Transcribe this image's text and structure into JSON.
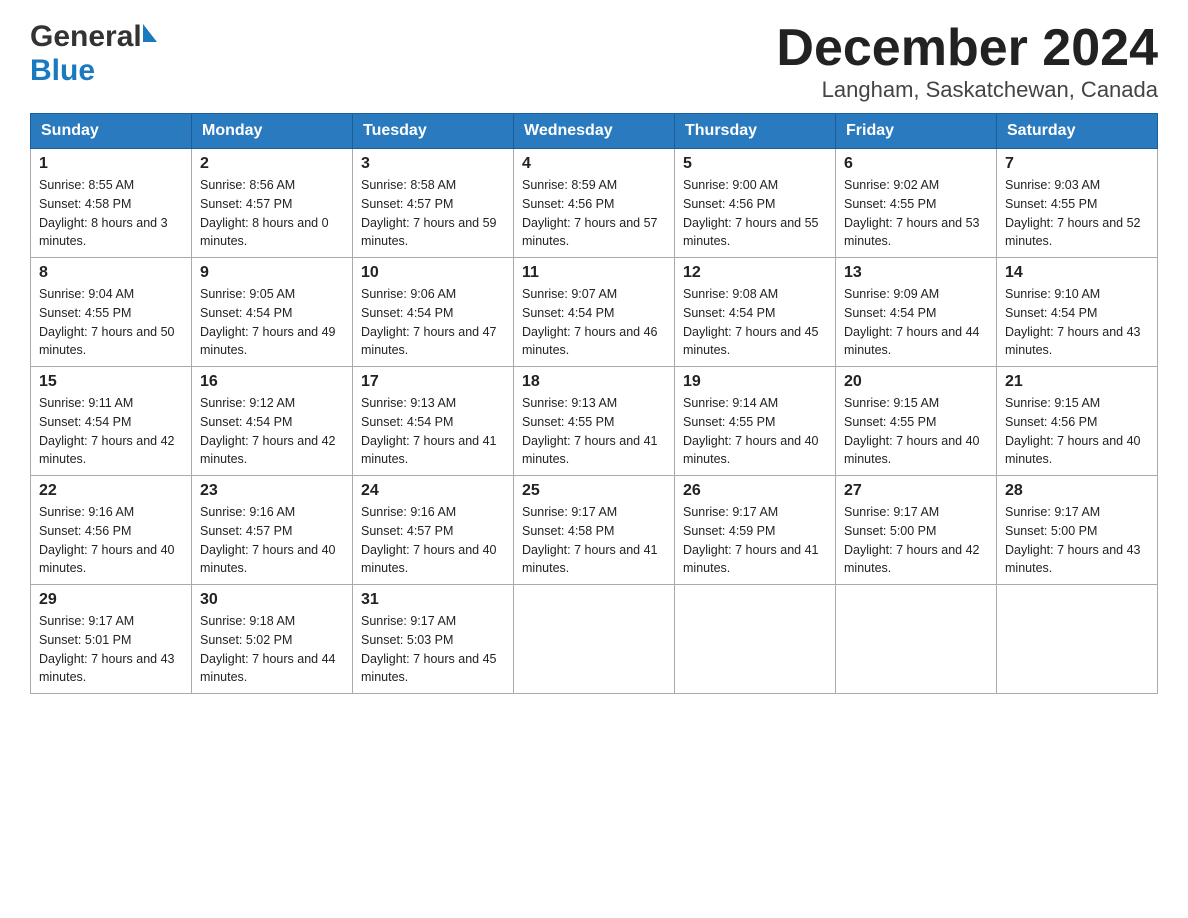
{
  "header": {
    "logo_general": "General",
    "logo_blue": "Blue",
    "title": "December 2024",
    "subtitle": "Langham, Saskatchewan, Canada"
  },
  "calendar": {
    "days_of_week": [
      "Sunday",
      "Monday",
      "Tuesday",
      "Wednesday",
      "Thursday",
      "Friday",
      "Saturday"
    ],
    "weeks": [
      [
        {
          "day": "1",
          "sunrise": "8:55 AM",
          "sunset": "4:58 PM",
          "daylight": "8 hours and 3 minutes."
        },
        {
          "day": "2",
          "sunrise": "8:56 AM",
          "sunset": "4:57 PM",
          "daylight": "8 hours and 0 minutes."
        },
        {
          "day": "3",
          "sunrise": "8:58 AM",
          "sunset": "4:57 PM",
          "daylight": "7 hours and 59 minutes."
        },
        {
          "day": "4",
          "sunrise": "8:59 AM",
          "sunset": "4:56 PM",
          "daylight": "7 hours and 57 minutes."
        },
        {
          "day": "5",
          "sunrise": "9:00 AM",
          "sunset": "4:56 PM",
          "daylight": "7 hours and 55 minutes."
        },
        {
          "day": "6",
          "sunrise": "9:02 AM",
          "sunset": "4:55 PM",
          "daylight": "7 hours and 53 minutes."
        },
        {
          "day": "7",
          "sunrise": "9:03 AM",
          "sunset": "4:55 PM",
          "daylight": "7 hours and 52 minutes."
        }
      ],
      [
        {
          "day": "8",
          "sunrise": "9:04 AM",
          "sunset": "4:55 PM",
          "daylight": "7 hours and 50 minutes."
        },
        {
          "day": "9",
          "sunrise": "9:05 AM",
          "sunset": "4:54 PM",
          "daylight": "7 hours and 49 minutes."
        },
        {
          "day": "10",
          "sunrise": "9:06 AM",
          "sunset": "4:54 PM",
          "daylight": "7 hours and 47 minutes."
        },
        {
          "day": "11",
          "sunrise": "9:07 AM",
          "sunset": "4:54 PM",
          "daylight": "7 hours and 46 minutes."
        },
        {
          "day": "12",
          "sunrise": "9:08 AM",
          "sunset": "4:54 PM",
          "daylight": "7 hours and 45 minutes."
        },
        {
          "day": "13",
          "sunrise": "9:09 AM",
          "sunset": "4:54 PM",
          "daylight": "7 hours and 44 minutes."
        },
        {
          "day": "14",
          "sunrise": "9:10 AM",
          "sunset": "4:54 PM",
          "daylight": "7 hours and 43 minutes."
        }
      ],
      [
        {
          "day": "15",
          "sunrise": "9:11 AM",
          "sunset": "4:54 PM",
          "daylight": "7 hours and 42 minutes."
        },
        {
          "day": "16",
          "sunrise": "9:12 AM",
          "sunset": "4:54 PM",
          "daylight": "7 hours and 42 minutes."
        },
        {
          "day": "17",
          "sunrise": "9:13 AM",
          "sunset": "4:54 PM",
          "daylight": "7 hours and 41 minutes."
        },
        {
          "day": "18",
          "sunrise": "9:13 AM",
          "sunset": "4:55 PM",
          "daylight": "7 hours and 41 minutes."
        },
        {
          "day": "19",
          "sunrise": "9:14 AM",
          "sunset": "4:55 PM",
          "daylight": "7 hours and 40 minutes."
        },
        {
          "day": "20",
          "sunrise": "9:15 AM",
          "sunset": "4:55 PM",
          "daylight": "7 hours and 40 minutes."
        },
        {
          "day": "21",
          "sunrise": "9:15 AM",
          "sunset": "4:56 PM",
          "daylight": "7 hours and 40 minutes."
        }
      ],
      [
        {
          "day": "22",
          "sunrise": "9:16 AM",
          "sunset": "4:56 PM",
          "daylight": "7 hours and 40 minutes."
        },
        {
          "day": "23",
          "sunrise": "9:16 AM",
          "sunset": "4:57 PM",
          "daylight": "7 hours and 40 minutes."
        },
        {
          "day": "24",
          "sunrise": "9:16 AM",
          "sunset": "4:57 PM",
          "daylight": "7 hours and 40 minutes."
        },
        {
          "day": "25",
          "sunrise": "9:17 AM",
          "sunset": "4:58 PM",
          "daylight": "7 hours and 41 minutes."
        },
        {
          "day": "26",
          "sunrise": "9:17 AM",
          "sunset": "4:59 PM",
          "daylight": "7 hours and 41 minutes."
        },
        {
          "day": "27",
          "sunrise": "9:17 AM",
          "sunset": "5:00 PM",
          "daylight": "7 hours and 42 minutes."
        },
        {
          "day": "28",
          "sunrise": "9:17 AM",
          "sunset": "5:00 PM",
          "daylight": "7 hours and 43 minutes."
        }
      ],
      [
        {
          "day": "29",
          "sunrise": "9:17 AM",
          "sunset": "5:01 PM",
          "daylight": "7 hours and 43 minutes."
        },
        {
          "day": "30",
          "sunrise": "9:18 AM",
          "sunset": "5:02 PM",
          "daylight": "7 hours and 44 minutes."
        },
        {
          "day": "31",
          "sunrise": "9:17 AM",
          "sunset": "5:03 PM",
          "daylight": "7 hours and 45 minutes."
        },
        null,
        null,
        null,
        null
      ]
    ]
  }
}
